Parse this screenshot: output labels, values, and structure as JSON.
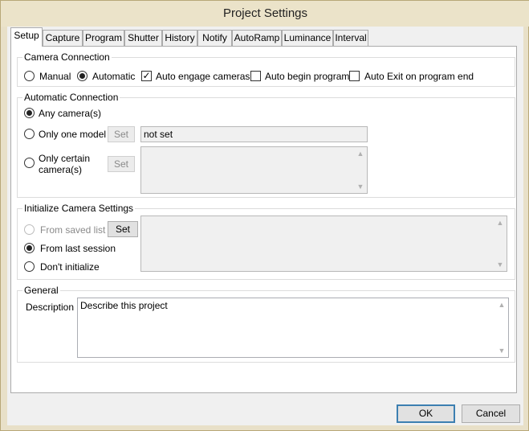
{
  "window": {
    "title": "Project Settings"
  },
  "tabs": [
    {
      "label": "Setup",
      "active": true
    },
    {
      "label": "Capture"
    },
    {
      "label": "Program"
    },
    {
      "label": "Shutter"
    },
    {
      "label": "History"
    },
    {
      "label": "Notify"
    },
    {
      "label": "AutoRamp"
    },
    {
      "label": "Luminance"
    },
    {
      "label": "Interval"
    }
  ],
  "camera_connection": {
    "title": "Camera Connection",
    "manual_label": "Manual",
    "automatic_label": "Automatic",
    "selected": "Automatic",
    "auto_engage_label": "Auto engage cameras",
    "auto_engage_checked": true,
    "auto_begin_label": "Auto begin program",
    "auto_begin_checked": false,
    "auto_exit_label": "Auto Exit on program end",
    "auto_exit_checked": false
  },
  "automatic_connection": {
    "title": "Automatic Connection",
    "any_label": "Any camera(s)",
    "one_model_label": "Only one model",
    "certain_label_1": "Only certain",
    "certain_label_2": "camera(s)",
    "selected": "Any camera(s)",
    "set_label": "Set",
    "model_value": "not set"
  },
  "initialize_camera": {
    "title": "Initialize Camera Settings",
    "saved_list_label": "From saved list",
    "last_session_label": "From last session",
    "dont_init_label": "Don't initialize",
    "selected": "From last session",
    "set_label": "Set"
  },
  "general": {
    "title": "General",
    "description_label": "Description",
    "description_value": "Describe this project"
  },
  "footer": {
    "ok_label": "OK",
    "cancel_label": "Cancel"
  }
}
